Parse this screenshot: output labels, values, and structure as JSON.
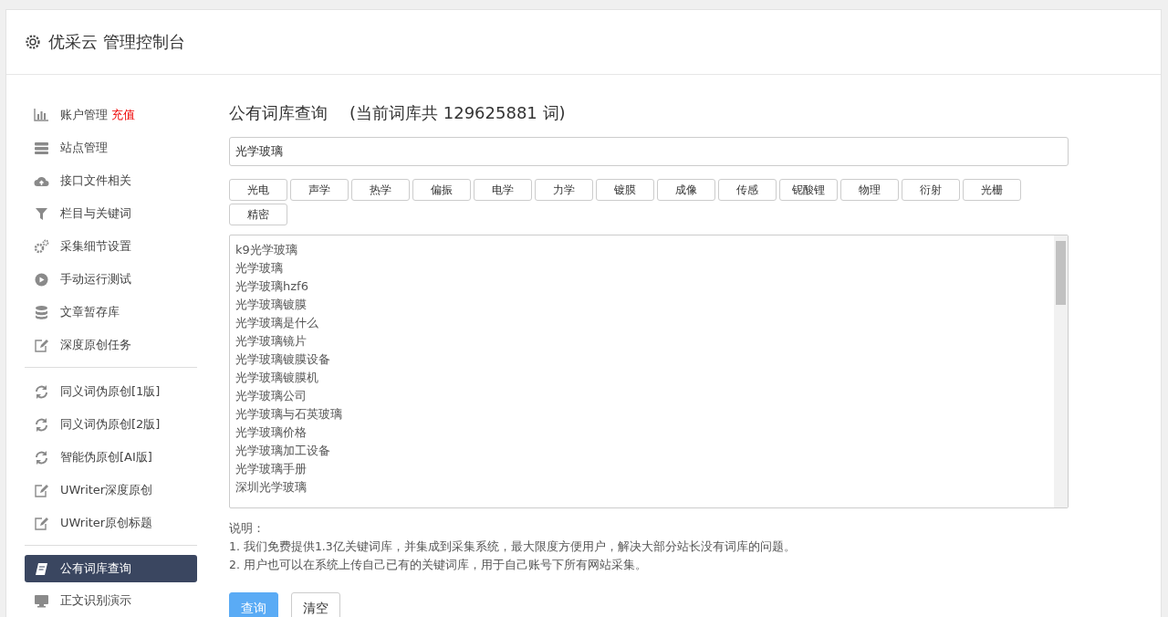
{
  "header": {
    "title": "优采云 管理控制台"
  },
  "sidebar": {
    "groups": [
      {
        "items": [
          {
            "label": "账户管理",
            "badge": "充值",
            "selected": false
          },
          {
            "label": "站点管理",
            "selected": false
          },
          {
            "label": "接口文件相关",
            "selected": false
          },
          {
            "label": "栏目与关键词",
            "selected": false
          },
          {
            "label": "采集细节设置",
            "selected": false
          },
          {
            "label": "手动运行测试",
            "selected": false
          },
          {
            "label": "文章暂存库",
            "selected": false
          },
          {
            "label": "深度原创任务",
            "selected": false
          }
        ]
      },
      {
        "items": [
          {
            "label": "同义词伪原创[1版]",
            "selected": false
          },
          {
            "label": "同义词伪原创[2版]",
            "selected": false
          },
          {
            "label": "智能伪原创[AI版]",
            "selected": false
          },
          {
            "label": "UWriter深度原创",
            "selected": false
          },
          {
            "label": "UWriter原创标题",
            "selected": false
          }
        ]
      },
      {
        "items": [
          {
            "label": "公有词库查询",
            "selected": true
          },
          {
            "label": "正文识别演示",
            "selected": false
          }
        ]
      }
    ]
  },
  "main": {
    "title": "公有词库查询",
    "subtitle": "(当前词库共 129625881 词)",
    "search": {
      "value": "光学玻璃"
    },
    "tags": [
      "光电",
      "声学",
      "热学",
      "偏振",
      "电学",
      "力学",
      "镀膜",
      "成像",
      "传感",
      "铌酸锂",
      "物理",
      "衍射",
      "光栅",
      "精密"
    ],
    "results": [
      "k9光学玻璃",
      "光学玻璃",
      "光学玻璃hzf6",
      "光学玻璃镀膜",
      "光学玻璃是什么",
      "光学玻璃镜片",
      "光学玻璃镀膜设备",
      "光学玻璃镀膜机",
      "光学玻璃公司",
      "光学玻璃与石英玻璃",
      "光学玻璃价格",
      "光学玻璃加工设备",
      "光学玻璃手册",
      "深圳光学玻璃"
    ],
    "notes_title": "说明：",
    "notes": [
      "1. 我们免费提供1.3亿关键词库，并集成到采集系统，最大限度方便用户，解决大部分站长没有词库的问题。",
      "2. 用户也可以在系统上传自己已有的关键词库，用于自己账号下所有网站采集。"
    ],
    "buttons": [
      {
        "label": "查询",
        "kind": "primary"
      },
      {
        "label": "清空",
        "kind": "default"
      }
    ]
  }
}
